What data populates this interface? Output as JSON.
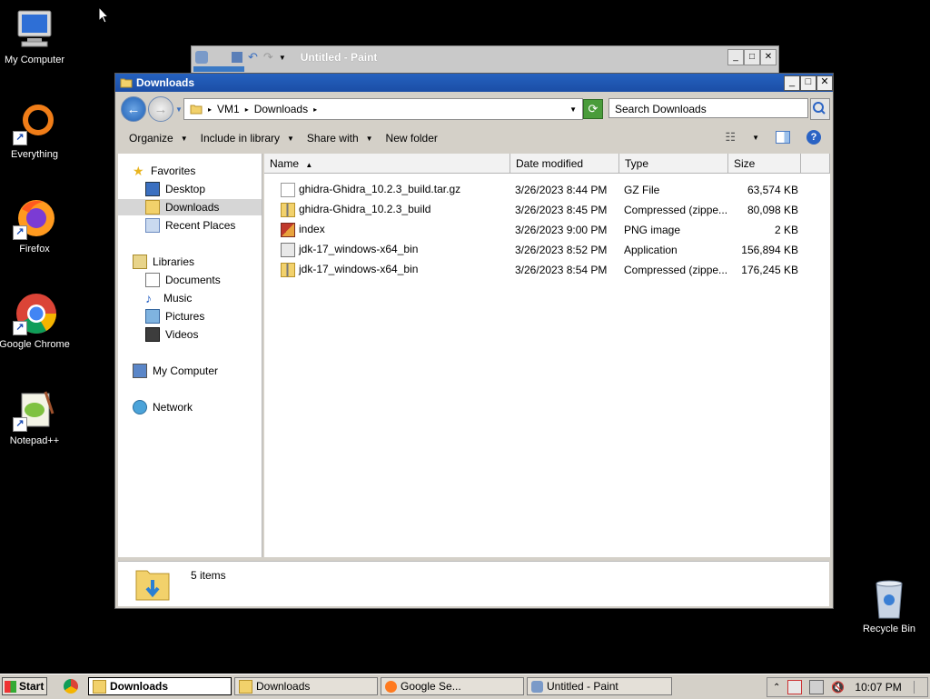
{
  "desktop": {
    "icons": [
      {
        "label": "My Computer"
      },
      {
        "label": "Everything"
      },
      {
        "label": "Firefox"
      },
      {
        "label": "Google Chrome"
      },
      {
        "label": "Notepad++"
      }
    ],
    "recycle_bin": "Recycle Bin"
  },
  "paint_window": {
    "title": "Untitled - Paint"
  },
  "explorer": {
    "title": "Downloads",
    "breadcrumb": [
      "VM1",
      "Downloads"
    ],
    "search_placeholder": "Search Downloads",
    "toolbar": {
      "organize": "Organize",
      "include_in_library": "Include in library",
      "share_with": "Share with",
      "new_folder": "New folder"
    },
    "nav": {
      "favorites": "Favorites",
      "desktop": "Desktop",
      "downloads": "Downloads",
      "recent_places": "Recent Places",
      "libraries": "Libraries",
      "documents": "Documents",
      "music": "Music",
      "pictures": "Pictures",
      "videos": "Videos",
      "my_computer": "My Computer",
      "network": "Network"
    },
    "columns": {
      "name": "Name",
      "date_modified": "Date modified",
      "type": "Type",
      "size": "Size"
    },
    "files": [
      {
        "name": "ghidra-Ghidra_10.2.3_build.tar.gz",
        "date": "3/26/2023 8:44 PM",
        "type": "GZ File",
        "size": "63,574 KB",
        "icon": "file-icon"
      },
      {
        "name": "ghidra-Ghidra_10.2.3_build",
        "date": "3/26/2023 8:45 PM",
        "type": "Compressed (zippe...",
        "size": "80,098 KB",
        "icon": "zip-icon"
      },
      {
        "name": "index",
        "date": "3/26/2023 9:00 PM",
        "type": "PNG image",
        "size": "2 KB",
        "icon": "image-icon"
      },
      {
        "name": "jdk-17_windows-x64_bin",
        "date": "3/26/2023 8:52 PM",
        "type": "Application",
        "size": "156,894 KB",
        "icon": "app-icon"
      },
      {
        "name": "jdk-17_windows-x64_bin",
        "date": "3/26/2023 8:54 PM",
        "type": "Compressed (zippe...",
        "size": "176,245 KB",
        "icon": "zip-icon"
      }
    ],
    "status": "5 items"
  },
  "taskbar": {
    "start": "Start",
    "buttons": [
      {
        "label": "Downloads",
        "active": true
      },
      {
        "label": "Downloads",
        "active": false
      },
      {
        "label": "Google Se...",
        "active": false
      },
      {
        "label": "Untitled - Paint",
        "active": false
      }
    ],
    "clock": "10:07 PM"
  },
  "colors": {
    "titlebar": "#1f57b5",
    "desktop": "#000000",
    "selection": "#d6d6d6"
  }
}
